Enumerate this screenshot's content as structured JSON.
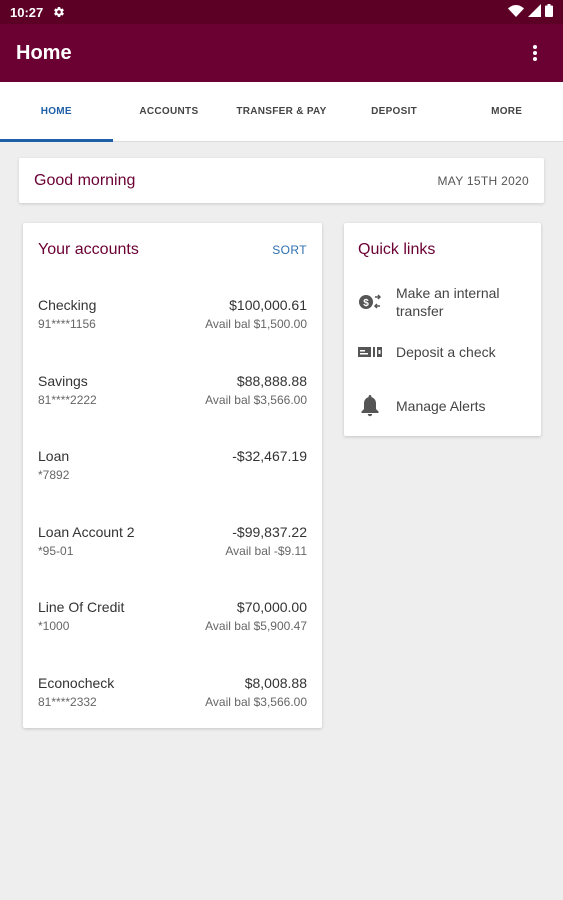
{
  "status_bar": {
    "time": "10:27"
  },
  "app_bar": {
    "title": "Home"
  },
  "tabs": [
    {
      "label": "HOME",
      "active": true
    },
    {
      "label": "ACCOUNTS",
      "active": false
    },
    {
      "label": "TRANSFER & PAY",
      "active": false
    },
    {
      "label": "DEPOSIT",
      "active": false
    },
    {
      "label": "MORE",
      "active": false
    }
  ],
  "greeting": {
    "text": "Good morning",
    "date": "MAY 15TH 2020"
  },
  "accounts": {
    "title": "Your accounts",
    "sort_label": "SORT",
    "items": [
      {
        "name": "Checking",
        "number": "91****1156",
        "balance": "$100,000.61",
        "available": "Avail bal $1,500.00"
      },
      {
        "name": "Savings",
        "number": "81****2222",
        "balance": "$88,888.88",
        "available": "Avail bal $3,566.00"
      },
      {
        "name": "Loan",
        "number": "*7892",
        "balance": "-$32,467.19",
        "available": ""
      },
      {
        "name": "Loan Account 2",
        "number": "*95-01",
        "balance": "-$99,837.22",
        "available": "Avail bal -$9.11"
      },
      {
        "name": "Line Of Credit",
        "number": "*1000",
        "balance": "$70,000.00",
        "available": "Avail bal $5,900.47"
      },
      {
        "name": "Econocheck",
        "number": "81****2332",
        "balance": "$8,008.88",
        "available": "Avail bal $3,566.00"
      }
    ]
  },
  "quick_links": {
    "title": "Quick links",
    "items": [
      {
        "label": "Make an internal transfer",
        "icon": "transfer-icon"
      },
      {
        "label": "Deposit a check",
        "icon": "check-deposit-icon"
      },
      {
        "label": "Manage Alerts",
        "icon": "bell-icon"
      }
    ]
  },
  "colors": {
    "brand": "#6b0033",
    "status_bar": "#5c0026",
    "accent": "#1f5fa8",
    "background": "#eeeeee"
  }
}
